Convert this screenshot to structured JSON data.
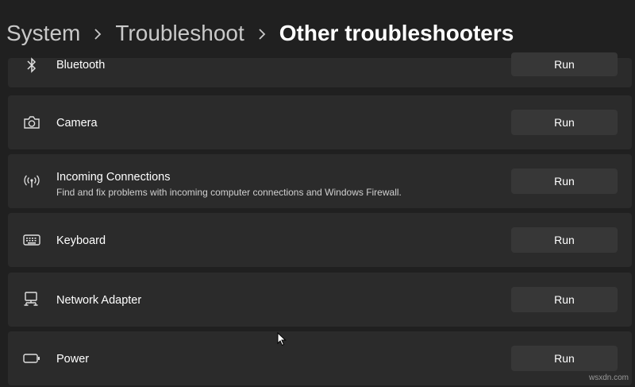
{
  "breadcrumb": {
    "items": [
      "System",
      "Troubleshoot",
      "Other troubleshooters"
    ]
  },
  "troubleshooters": [
    {
      "title": "Bluetooth",
      "description": "",
      "icon": "bluetooth-icon",
      "button": "Run"
    },
    {
      "title": "Camera",
      "description": "",
      "icon": "camera-icon",
      "button": "Run"
    },
    {
      "title": "Incoming Connections",
      "description": "Find and fix problems with incoming computer connections and Windows Firewall.",
      "icon": "antenna-icon",
      "button": "Run"
    },
    {
      "title": "Keyboard",
      "description": "",
      "icon": "keyboard-icon",
      "button": "Run"
    },
    {
      "title": "Network Adapter",
      "description": "",
      "icon": "network-adapter-icon",
      "button": "Run"
    },
    {
      "title": "Power",
      "description": "",
      "icon": "battery-icon",
      "button": "Run"
    }
  ],
  "watermark": "wsxdn.com",
  "colors": {
    "background": "#202020",
    "card": "#2b2b2b",
    "button": "#373737",
    "text": "#ffffff"
  }
}
